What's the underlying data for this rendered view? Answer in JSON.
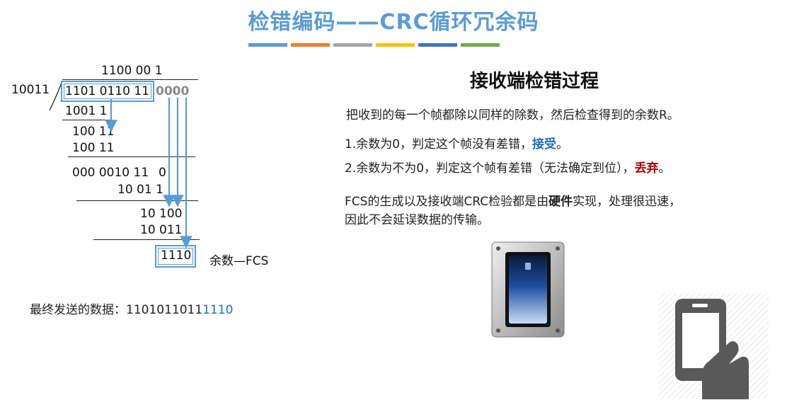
{
  "title": "检错编码——CRC循环冗余码",
  "color_bars": [
    "#5b9bd5",
    "#ed7d31",
    "#a5a5a5",
    "#ffc000",
    "#4472c4",
    "#70ad47"
  ],
  "division": {
    "quotient": "1100 00 1",
    "divisor": "10011",
    "dividend_data": "1101 0110 11",
    "dividend_fcs": "0000",
    "step1": "1001 1",
    "step2": "100 11",
    "step3": "100 11",
    "step4_a": "000 0010 11",
    "step4_b": "0",
    "step5": "10 01 1",
    "step6": "10 100",
    "step7": "10 011",
    "remainder": "1110",
    "remainder_label": "余数—FCS"
  },
  "final": {
    "label": "最终发送的数据：",
    "data": "1101011011",
    "fcs": "1110"
  },
  "right": {
    "heading": "接收端检错过程",
    "intro": "把收到的每一个帧都除以同样的除数，然后检查得到的余数R。",
    "item1_text": "1.余数为0，判定这个帧没有差错，",
    "item1_accent": "接受",
    "item1_end": "。",
    "item2_text": "2.余数为不为0，判定这个帧有差错（无法确定到位），",
    "item2_accent": "丢弃",
    "item2_end": "。",
    "fcs_line1_a": "FCS的生成以及接收端CRC检验都是由",
    "fcs_line1_bold": "硬件",
    "fcs_line1_b": "实现，处理很迅速，",
    "fcs_line2": "因此不会延误数据的传输。"
  }
}
